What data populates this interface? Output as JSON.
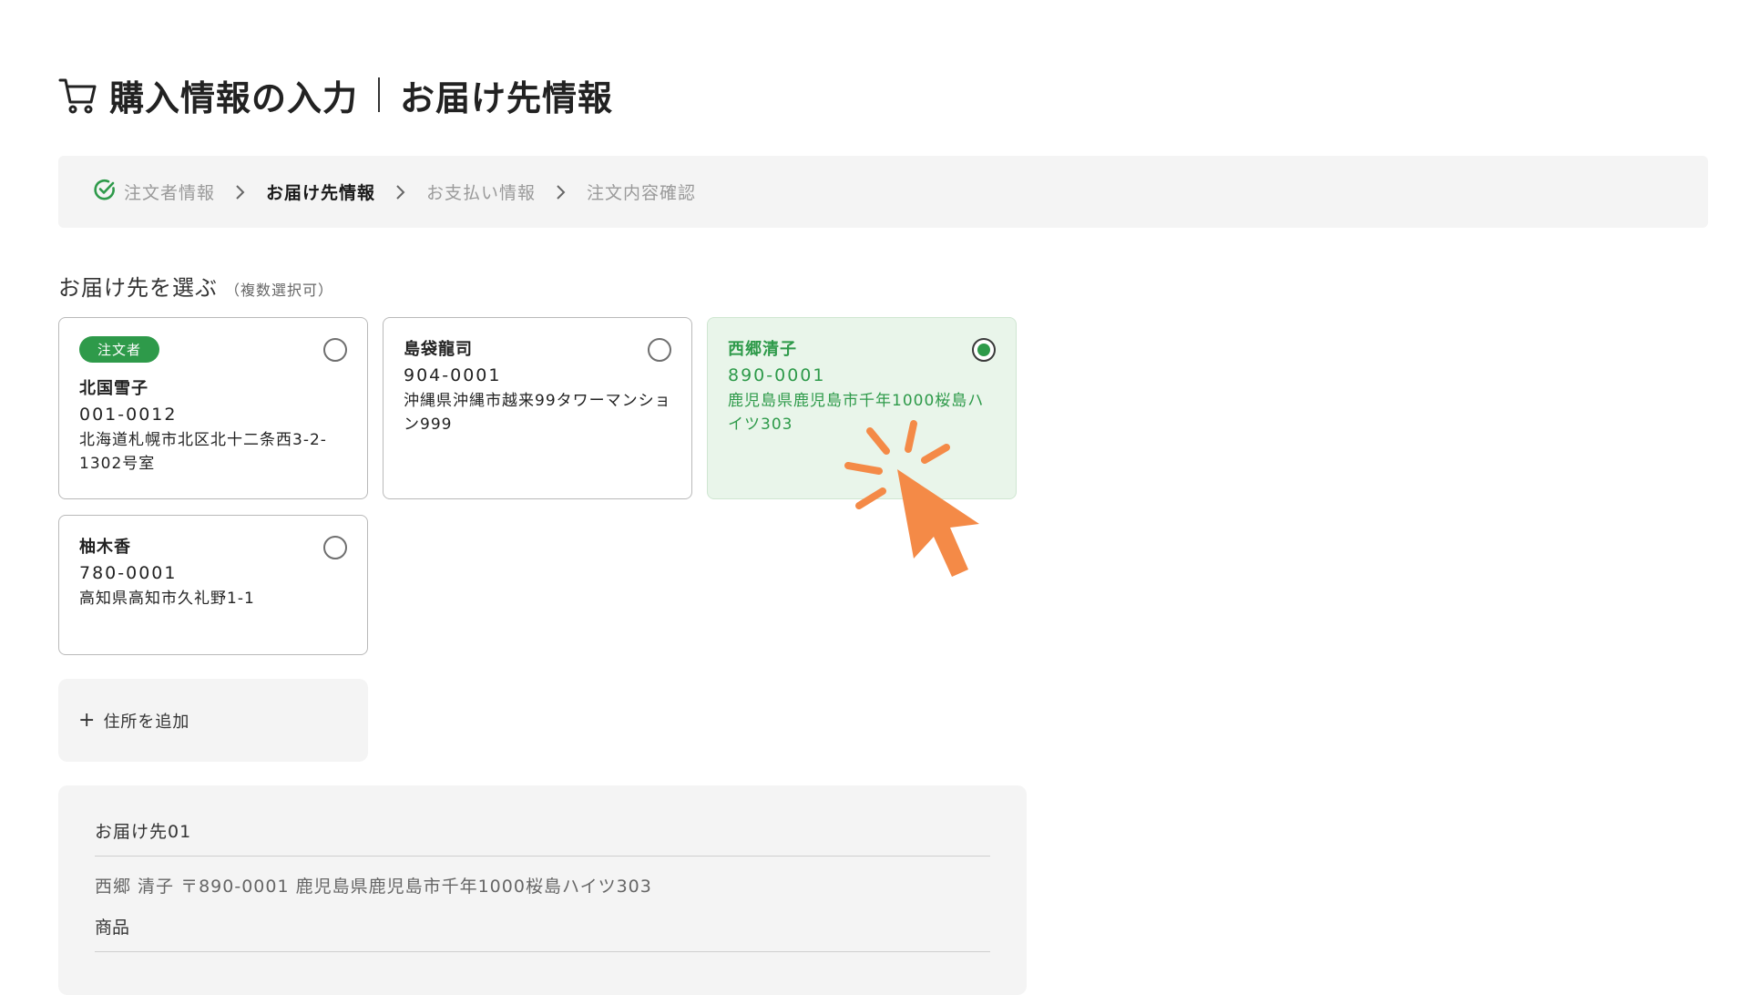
{
  "header": {
    "title": "購入情報の入力",
    "subtitle": "お届け先情報"
  },
  "stepper": {
    "steps": [
      {
        "label": "注文者情報",
        "state": "done"
      },
      {
        "label": "お届け先情報",
        "state": "current"
      },
      {
        "label": "お支払い情報",
        "state": "upcoming"
      },
      {
        "label": "注文内容確認",
        "state": "upcoming"
      }
    ]
  },
  "section": {
    "title": "お届け先を選ぶ",
    "note": "（複数選択可）"
  },
  "addresses": [
    {
      "badge": "注文者",
      "name": "北国雪子",
      "zip": "001-0012",
      "address": "北海道札幌市北区北十二条西3-2-1302号室",
      "selected": false
    },
    {
      "name": "島袋龍司",
      "zip": "904-0001",
      "address": "沖縄県沖縄市越来99タワーマンション999",
      "selected": false
    },
    {
      "name": "西郷清子",
      "zip": "890-0001",
      "address": "鹿児島県鹿児島市千年1000桜島ハイツ303",
      "selected": true
    },
    {
      "name": "柚木香",
      "zip": "780-0001",
      "address": "高知県高知市久礼野1-1",
      "selected": false
    }
  ],
  "add_address": {
    "icon": "+",
    "label": "住所を追加"
  },
  "summary": {
    "heading": "お届け先01",
    "destination": "西郷 清子  〒890-0001  鹿児島県鹿児島市千年1000桜島ハイツ303",
    "products_label": "商品"
  },
  "colors": {
    "accent": "#2e9a4a",
    "selected_bg": "#e9f5ea",
    "cursor": "#f48a47"
  }
}
